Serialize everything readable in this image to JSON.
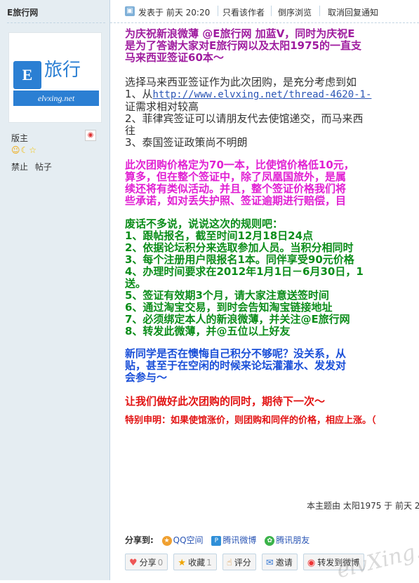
{
  "sidebar": {
    "username": "E旅行网",
    "avatar_brand": "旅行",
    "avatar_letter": "E",
    "avatar_url": "elvxing.net",
    "rank": "版主",
    "actions": [
      "禁止",
      "帖子"
    ]
  },
  "topbar": {
    "posted": "发表于 前天 20:20",
    "only_author": "只看该作者",
    "reverse": "倒序浏览",
    "cancel_notify": "取消回复通知"
  },
  "post": {
    "intro": [
      "为庆祝新浪微薄 @E旅行网 加蓝V，同时为庆祝E",
      "是为了答谢大家对E旅行网以及太阳1975的一直支",
      "马来西亚签证60本～"
    ],
    "reason_intro": "选择马来西亚签证作为此次团购，是充分考虑到如",
    "reason1_prefix": "1、从",
    "reason1_link": "http://www.elvxing.net/thread-4620-1-",
    "reason1_tail": "证需求相对较高",
    "reason2": [
      "2、菲律宾签证可以请朋友代去使馆递交，而马来西",
      "往"
    ],
    "reason3": "3、泰国签证政策尚不明朗",
    "price": [
      "此次团购价格定为70一本，比使馆价格低10元，",
      "算多，但在整个签证中，除了凤凰国旅外，是属",
      "续还将有类似活动。并且，整个签证价格我们将",
      "些承诺，如对丢失护照、签证逾期进行赔偿，目"
    ],
    "rules_title": "废话不多说，说说这次的规则吧：",
    "rules": [
      "1、跟帖报名，截至时间12月18日24点",
      "2、依据论坛积分来选取参加人员。当积分相同时",
      "3、每个注册用户限报名1本。同伴享受90元价格",
      "4、办理时间要求在2012年1月1日－6月30日，1",
      "送。",
      "5、签证有效期3个月，请大家注意送签时间",
      "6、通过淘宝交易，到时会告知淘宝链接地址",
      "7、必须绑定本人的新浪微薄，并关注@E旅行网",
      "8、转发此微薄，并@五位以上好友"
    ],
    "newbie": [
      "新同学是否在懊悔自己积分不够呢？没关系，从",
      "贴，甚至于在空闲的时候来论坛灌灌水、发发对",
      "会参与～"
    ],
    "closing": "让我们做好此次团购的同时，期待下一次～",
    "notice": "特别申明：如果使馆涨价，则团购和同伴的价格，相应上涨。（"
  },
  "footer": {
    "edited": "本主题由 太阳1975 于 前天 2"
  },
  "share": {
    "label": "分享到:",
    "targets": [
      "QQ空间",
      "腾讯微博",
      "腾讯朋友"
    ]
  },
  "buttons": {
    "share": "分享",
    "share_count": "0",
    "fav": "收藏",
    "fav_count": "1",
    "rate": "评分",
    "invite": "邀请",
    "repost": "转发到微博"
  },
  "watermark": "elvXing.net"
}
